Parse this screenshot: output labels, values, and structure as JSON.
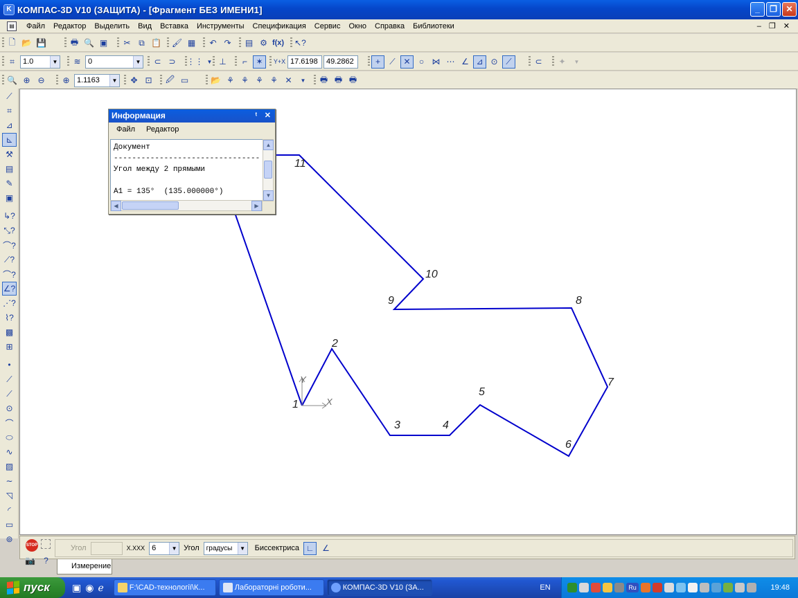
{
  "window": {
    "title": "КОМПАС-3D V10 (ЗАЩИТА) - [Фрагмент БЕЗ ИМЕНИ1]",
    "app_icon": "kompas-icon"
  },
  "menu": [
    "Файл",
    "Редактор",
    "Выделить",
    "Вид",
    "Вставка",
    "Инструменты",
    "Спецификация",
    "Сервис",
    "Окно",
    "Справка",
    "Библиотеки"
  ],
  "toolbar2": {
    "step": "1.0",
    "layer": "0",
    "x_coord": "17.6198",
    "y_coord": "49.2862"
  },
  "toolbar3": {
    "zoom": "1.1163"
  },
  "info_panel": {
    "title": "Информация",
    "menu": [
      "Файл",
      "Редактор"
    ],
    "lines": [
      "Документ",
      "----------------------------------",
      "Угол между 2 прямыми",
      "",
      "A1 = 135°  (135.000000°)"
    ]
  },
  "drawing": {
    "line_color": "#0000cc",
    "points": [
      {
        "label": "1"
      },
      {
        "label": "2"
      },
      {
        "label": "3"
      },
      {
        "label": "4"
      },
      {
        "label": "5"
      },
      {
        "label": "6"
      },
      {
        "label": "7"
      },
      {
        "label": "8"
      },
      {
        "label": "9"
      },
      {
        "label": "10"
      },
      {
        "label": "11"
      }
    ],
    "axis_x": "X",
    "axis_y": "Y"
  },
  "property_bar": {
    "angle_label": "Угол",
    "precision_label": "X.XXX",
    "precision_value": "6",
    "unit_label": "Угол",
    "unit_value": "градусы",
    "bisector_label": "Биссектриса"
  },
  "bottom_tab": "Измерение",
  "taskbar": {
    "start": "пуск",
    "tasks": [
      "F:\\CAD-технології\\К...",
      "Лабораторні роботи...",
      "КОМПАС-3D V10 (ЗА..."
    ],
    "lang": "EN",
    "tray_lang": "Ru",
    "clock": "19:48"
  }
}
